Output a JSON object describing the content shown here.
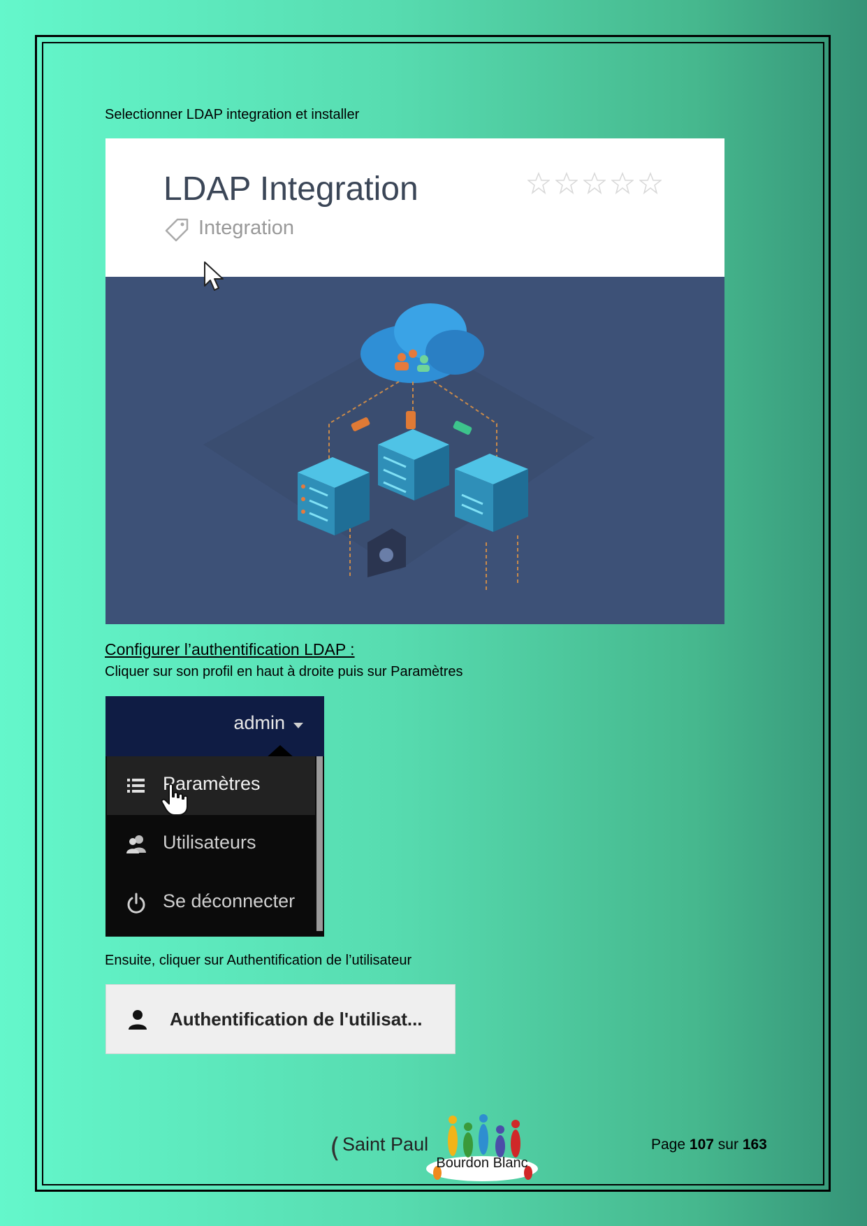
{
  "instruction_1": "Selectionner LDAP integration et installer",
  "ldap_card": {
    "title": "LDAP Integration",
    "tag": "Integration",
    "rating_stars": 5
  },
  "section_heading": "Configurer l’authentification LDAP :",
  "instruction_2": "Cliquer sur son profil en haut à droite puis sur Paramètres",
  "admin_menu": {
    "user": "admin",
    "items": [
      {
        "label": "Paramètres",
        "icon": "list-icon"
      },
      {
        "label": "Utilisateurs",
        "icon": "users-icon"
      },
      {
        "label": "Se déconnecter",
        "icon": "power-icon"
      }
    ]
  },
  "instruction_3": "Ensuite, cliquer sur Authentification de l’utilisateur",
  "auth_button": {
    "label": "Authentification de l'utilisat..."
  },
  "footer": {
    "paren": "(",
    "school_line1": "Saint Paul",
    "logo_text": "Bourdon Blanc",
    "page_prefix": "Page",
    "page_current": "107",
    "page_sep": "sur",
    "page_total": "163"
  }
}
